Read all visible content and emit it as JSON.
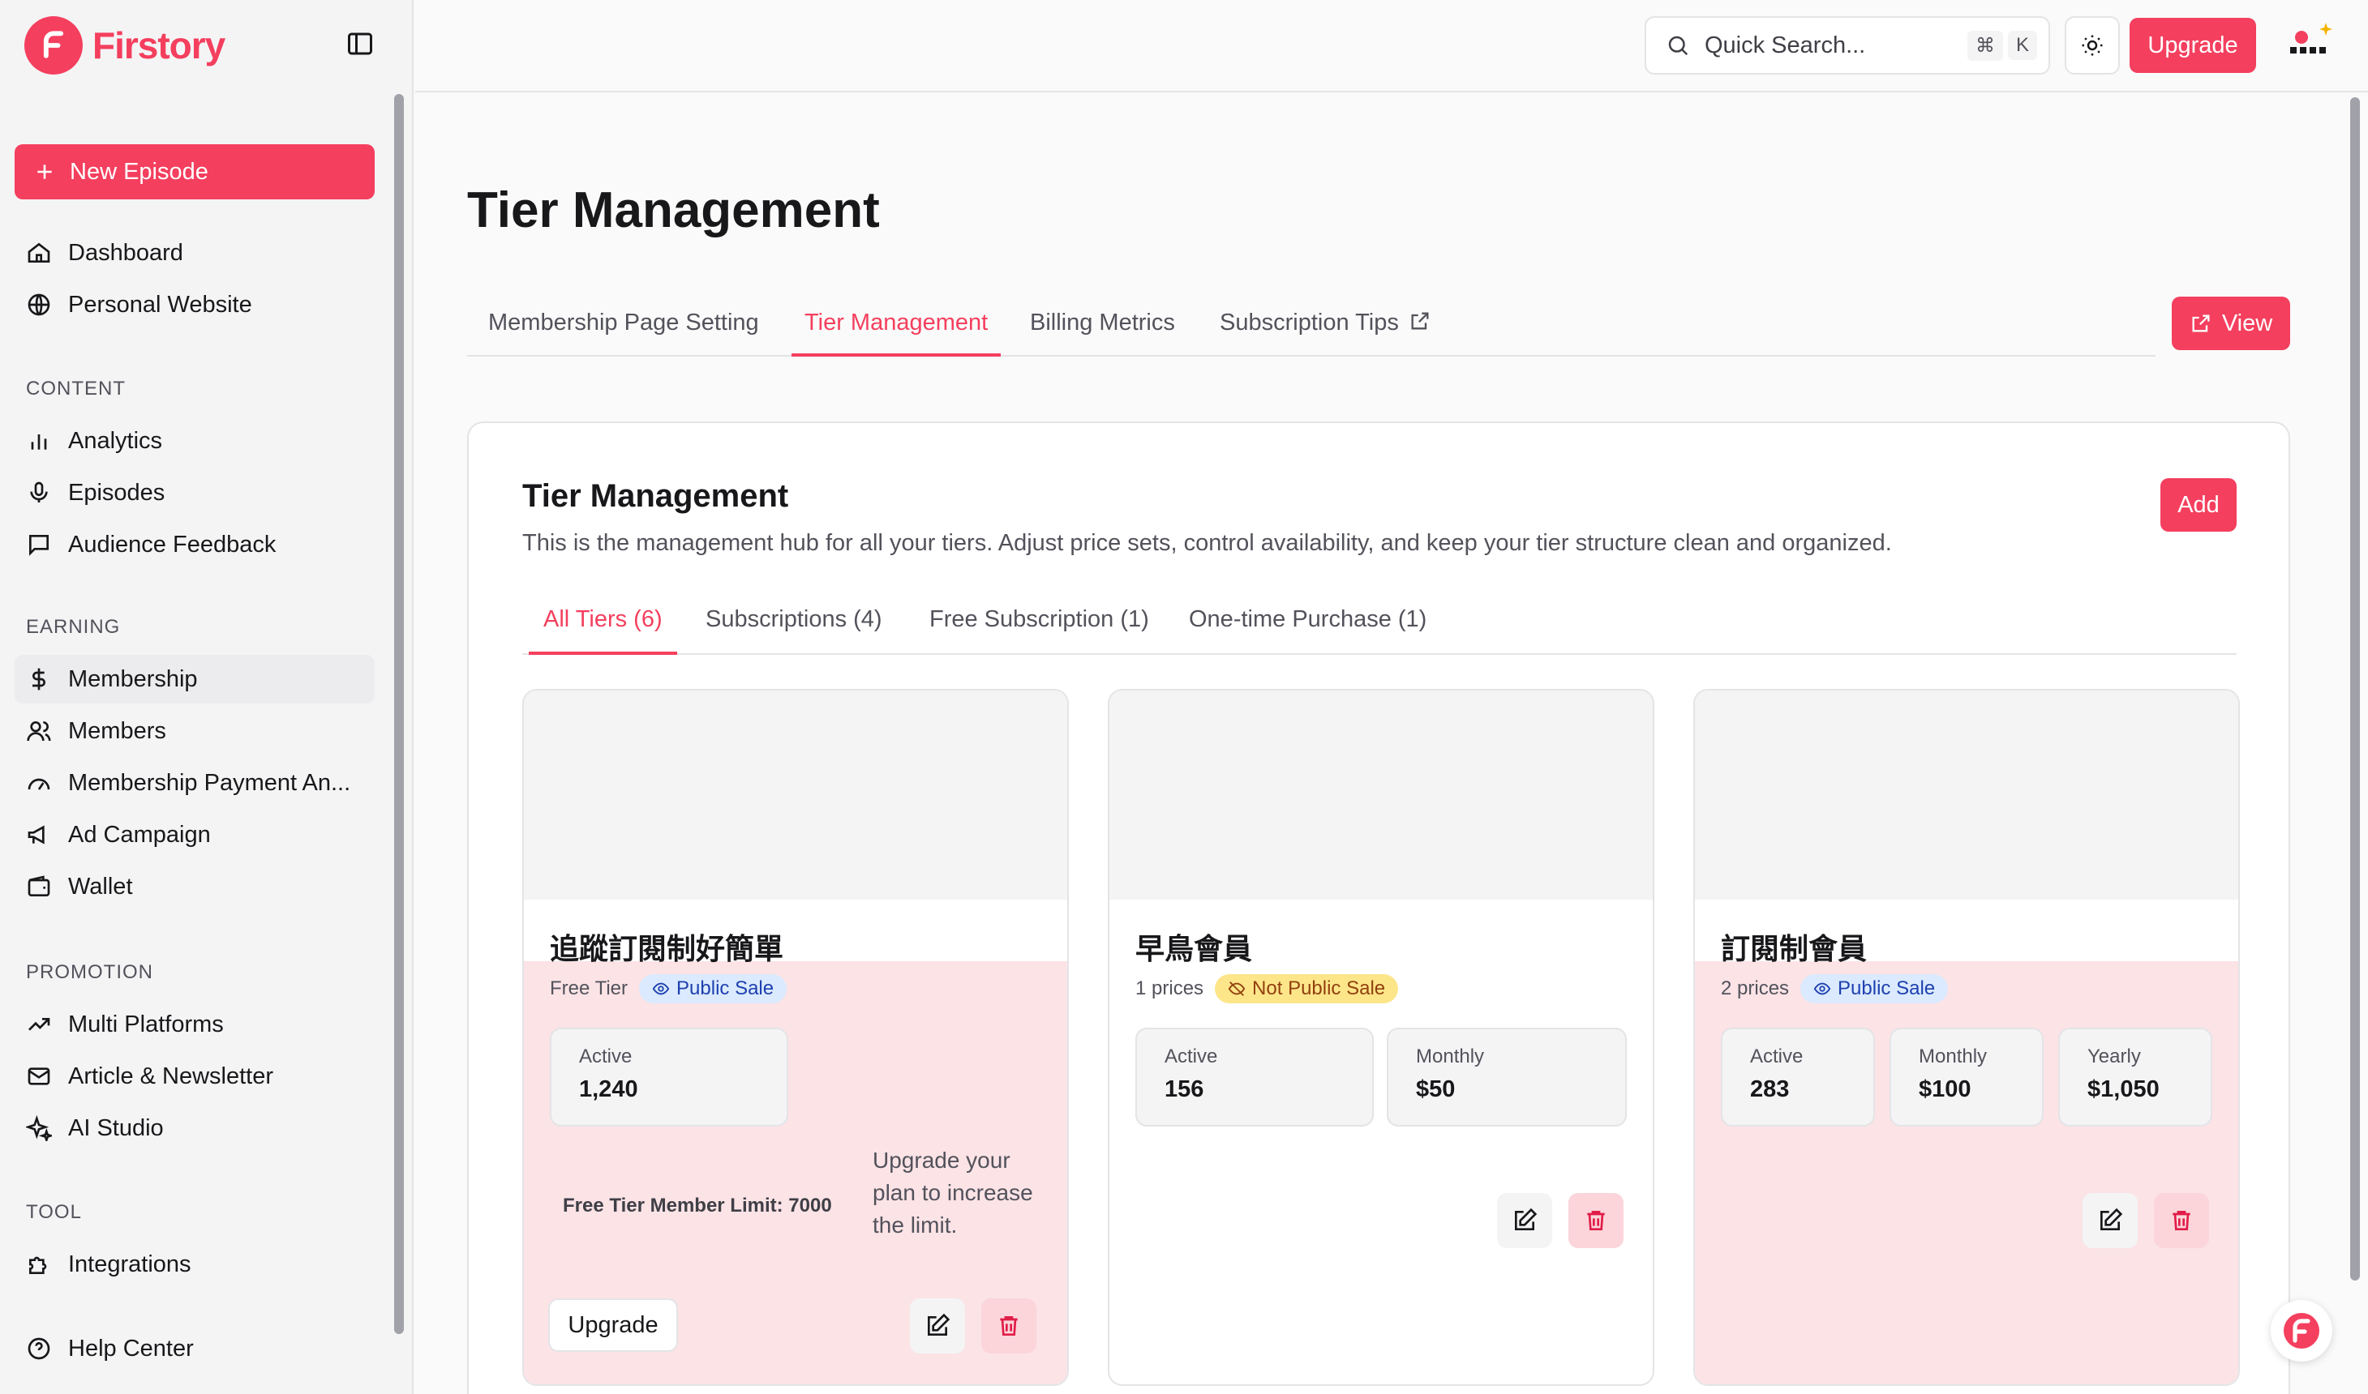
{
  "app": {
    "brand": "Firstory",
    "accent": "#f43f5e"
  },
  "sidebar": {
    "new_episode": "New Episode",
    "top_items": [
      {
        "label": "Dashboard",
        "icon": "home-icon"
      },
      {
        "label": "Personal Website",
        "icon": "globe-icon"
      }
    ],
    "sections": [
      {
        "title": "CONTENT",
        "items": [
          {
            "label": "Analytics",
            "icon": "bar-chart-icon"
          },
          {
            "label": "Episodes",
            "icon": "microphone-icon"
          },
          {
            "label": "Audience Feedback",
            "icon": "message-icon"
          }
        ]
      },
      {
        "title": "EARNING",
        "items": [
          {
            "label": "Membership",
            "icon": "dollar-icon"
          },
          {
            "label": "Members",
            "icon": "users-icon"
          },
          {
            "label": "Membership Payment An...",
            "icon": "gauge-icon"
          },
          {
            "label": "Ad Campaign",
            "icon": "megaphone-icon"
          },
          {
            "label": "Wallet",
            "icon": "wallet-icon"
          }
        ]
      },
      {
        "title": "PROMOTION",
        "items": [
          {
            "label": "Multi Platforms",
            "icon": "trend-icon"
          },
          {
            "label": "Article & Newsletter",
            "icon": "mail-icon"
          },
          {
            "label": "AI Studio",
            "icon": "sparkle-icon"
          }
        ]
      },
      {
        "title": "TOOL",
        "items": [
          {
            "label": "Integrations",
            "icon": "puzzle-icon"
          }
        ]
      }
    ],
    "help": "Help Center"
  },
  "topbar": {
    "search_placeholder": "Quick Search...",
    "shortcut_cmd": "⌘",
    "shortcut_key": "K",
    "upgrade": "Upgrade"
  },
  "page": {
    "title": "Tier Management",
    "tabs": [
      "Membership Page Setting",
      "Tier Management",
      "Billing Metrics",
      "Subscription Tips"
    ],
    "view_button": "View"
  },
  "panel": {
    "title": "Tier Management",
    "description": "This is the management hub for all your tiers. Adjust price sets, control availability, and keep your tier structure clean and organized.",
    "add_button": "Add",
    "subtabs": [
      "All Tiers (6)",
      "Subscriptions (4)",
      "Free Subscription (1)",
      "One-time Purchase (1)"
    ]
  },
  "tiers": [
    {
      "name": "追蹤訂閱制好簡單",
      "meta": "Free Tier",
      "badge": "Public Sale",
      "stats": [
        {
          "label": "Active",
          "value": "1,240"
        }
      ],
      "limit_text": "Free Tier Member Limit: 7000",
      "limit_note": "Upgrade your plan to increase the limit.",
      "upgrade_label": "Upgrade"
    },
    {
      "name": "早鳥會員",
      "meta": "1 prices",
      "badge": "Not Public Sale",
      "stats": [
        {
          "label": "Active",
          "value": "156"
        },
        {
          "label": "Monthly",
          "value": "$50"
        }
      ]
    },
    {
      "name": "訂閱制會員",
      "meta": "2 prices",
      "badge": "Public Sale",
      "stats": [
        {
          "label": "Active",
          "value": "283"
        },
        {
          "label": "Monthly",
          "value": "$100"
        },
        {
          "label": "Yearly",
          "value": "$1,050"
        }
      ]
    }
  ]
}
